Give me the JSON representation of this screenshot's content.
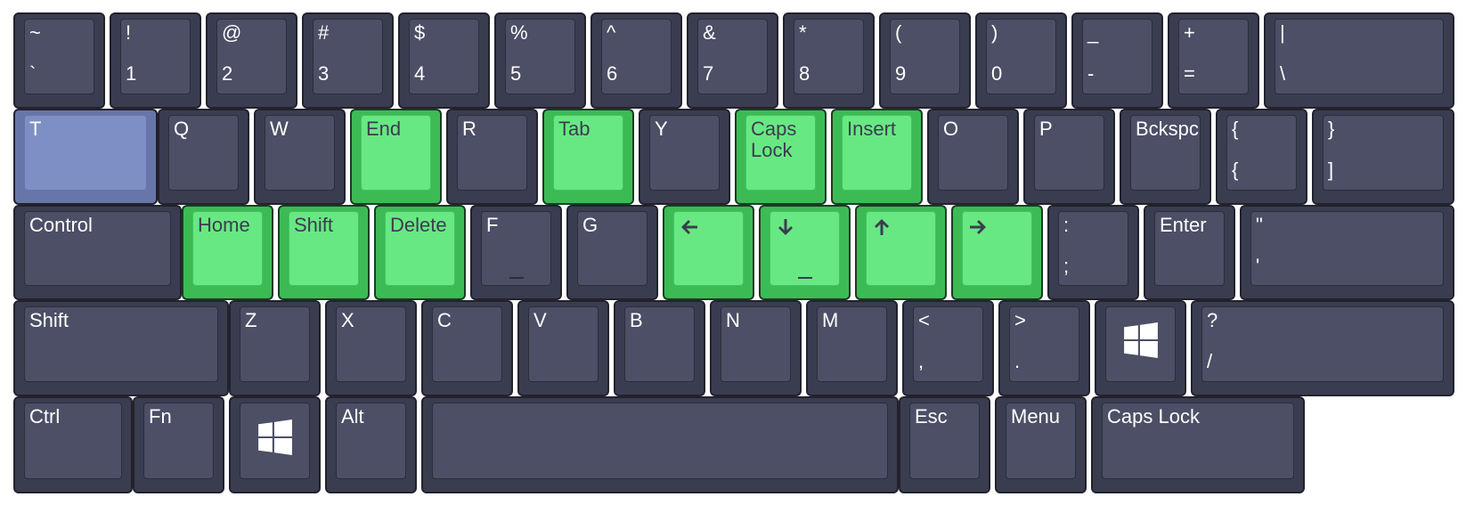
{
  "keyboard": {
    "colors": {
      "key_default": "#3a3d50",
      "key_cap": "#4c4f65",
      "key_highlight_green": "#68e882",
      "key_highlight_blue": "#7d8fc4",
      "border": "#22222d"
    },
    "rows": [
      [
        {
          "name": "key-tilde",
          "top": "~",
          "bottom": "`"
        },
        {
          "name": "key-1",
          "top": "!",
          "bottom": "1"
        },
        {
          "name": "key-2",
          "top": "@",
          "bottom": "2"
        },
        {
          "name": "key-3",
          "top": "#",
          "bottom": "3"
        },
        {
          "name": "key-4",
          "top": "$",
          "bottom": "4"
        },
        {
          "name": "key-5",
          "top": "%",
          "bottom": "5"
        },
        {
          "name": "key-6",
          "top": "^",
          "bottom": "6"
        },
        {
          "name": "key-7",
          "top": "&",
          "bottom": "7"
        },
        {
          "name": "key-8",
          "top": "*",
          "bottom": "8"
        },
        {
          "name": "key-9",
          "top": "(",
          "bottom": "9"
        },
        {
          "name": "key-0",
          "top": ")",
          "bottom": "0"
        },
        {
          "name": "key-minus",
          "top": "_",
          "bottom": "-"
        },
        {
          "name": "key-equals",
          "top": "+",
          "bottom": "="
        },
        {
          "name": "key-backslash",
          "top": "|",
          "bottom": "\\"
        }
      ],
      [
        {
          "name": "key-t-remapped",
          "label": "T",
          "highlight": "blue"
        },
        {
          "name": "key-q",
          "label": "Q"
        },
        {
          "name": "key-w",
          "label": "W"
        },
        {
          "name": "key-end",
          "label": "End",
          "highlight": "green"
        },
        {
          "name": "key-r",
          "label": "R"
        },
        {
          "name": "key-tab",
          "label": "Tab",
          "highlight": "green"
        },
        {
          "name": "key-y",
          "label": "Y"
        },
        {
          "name": "key-caps-lock-remapped",
          "label": "Caps\nLock",
          "highlight": "green"
        },
        {
          "name": "key-insert",
          "label": "Insert",
          "highlight": "green"
        },
        {
          "name": "key-o",
          "label": "O"
        },
        {
          "name": "key-p",
          "label": "P"
        },
        {
          "name": "key-backspace",
          "label": "Bckspc"
        },
        {
          "name": "key-left-brace",
          "top": "{",
          "bottom": "{"
        },
        {
          "name": "key-right-brace",
          "top": "}",
          "bottom": "]"
        }
      ],
      [
        {
          "name": "key-control",
          "label": "Control"
        },
        {
          "name": "key-home",
          "label": "Home",
          "highlight": "green"
        },
        {
          "name": "key-shift-remapped",
          "label": "Shift",
          "highlight": "green"
        },
        {
          "name": "key-delete",
          "label": "Delete",
          "highlight": "green"
        },
        {
          "name": "key-f",
          "label": "F",
          "bump": true
        },
        {
          "name": "key-g",
          "label": "G"
        },
        {
          "name": "key-arrow-left",
          "icon": "arrow-left-icon",
          "highlight": "green"
        },
        {
          "name": "key-arrow-down",
          "icon": "arrow-down-icon",
          "highlight": "green",
          "bump": true
        },
        {
          "name": "key-arrow-up",
          "icon": "arrow-up-icon",
          "highlight": "green"
        },
        {
          "name": "key-arrow-right",
          "icon": "arrow-right-icon",
          "highlight": "green"
        },
        {
          "name": "key-semicolon",
          "top": ":",
          "bottom": ";"
        },
        {
          "name": "key-enter",
          "label": "Enter"
        },
        {
          "name": "key-quote",
          "top": "\"",
          "bottom": "'"
        }
      ],
      [
        {
          "name": "key-left-shift",
          "label": "Shift"
        },
        {
          "name": "key-z",
          "label": "Z"
        },
        {
          "name": "key-x",
          "label": "X"
        },
        {
          "name": "key-c",
          "label": "C"
        },
        {
          "name": "key-v",
          "label": "V"
        },
        {
          "name": "key-b",
          "label": "B"
        },
        {
          "name": "key-n",
          "label": "N"
        },
        {
          "name": "key-m",
          "label": "M"
        },
        {
          "name": "key-comma",
          "top": "<",
          "bottom": ","
        },
        {
          "name": "key-period",
          "top": ">",
          "bottom": "."
        },
        {
          "name": "key-windows-right",
          "logo": "windows-logo-icon"
        },
        {
          "name": "key-slash",
          "top": "?",
          "bottom": "/"
        }
      ],
      [
        {
          "name": "key-ctrl",
          "label": "Ctrl"
        },
        {
          "name": "key-fn",
          "label": "Fn"
        },
        {
          "name": "key-windows-left",
          "logo": "windows-logo-icon"
        },
        {
          "name": "key-alt",
          "label": "Alt"
        },
        {
          "name": "key-space",
          "label": ""
        },
        {
          "name": "key-esc",
          "label": "Esc"
        },
        {
          "name": "key-menu",
          "label": "Menu"
        },
        {
          "name": "key-caps-lock",
          "label": "Caps Lock"
        }
      ]
    ]
  }
}
